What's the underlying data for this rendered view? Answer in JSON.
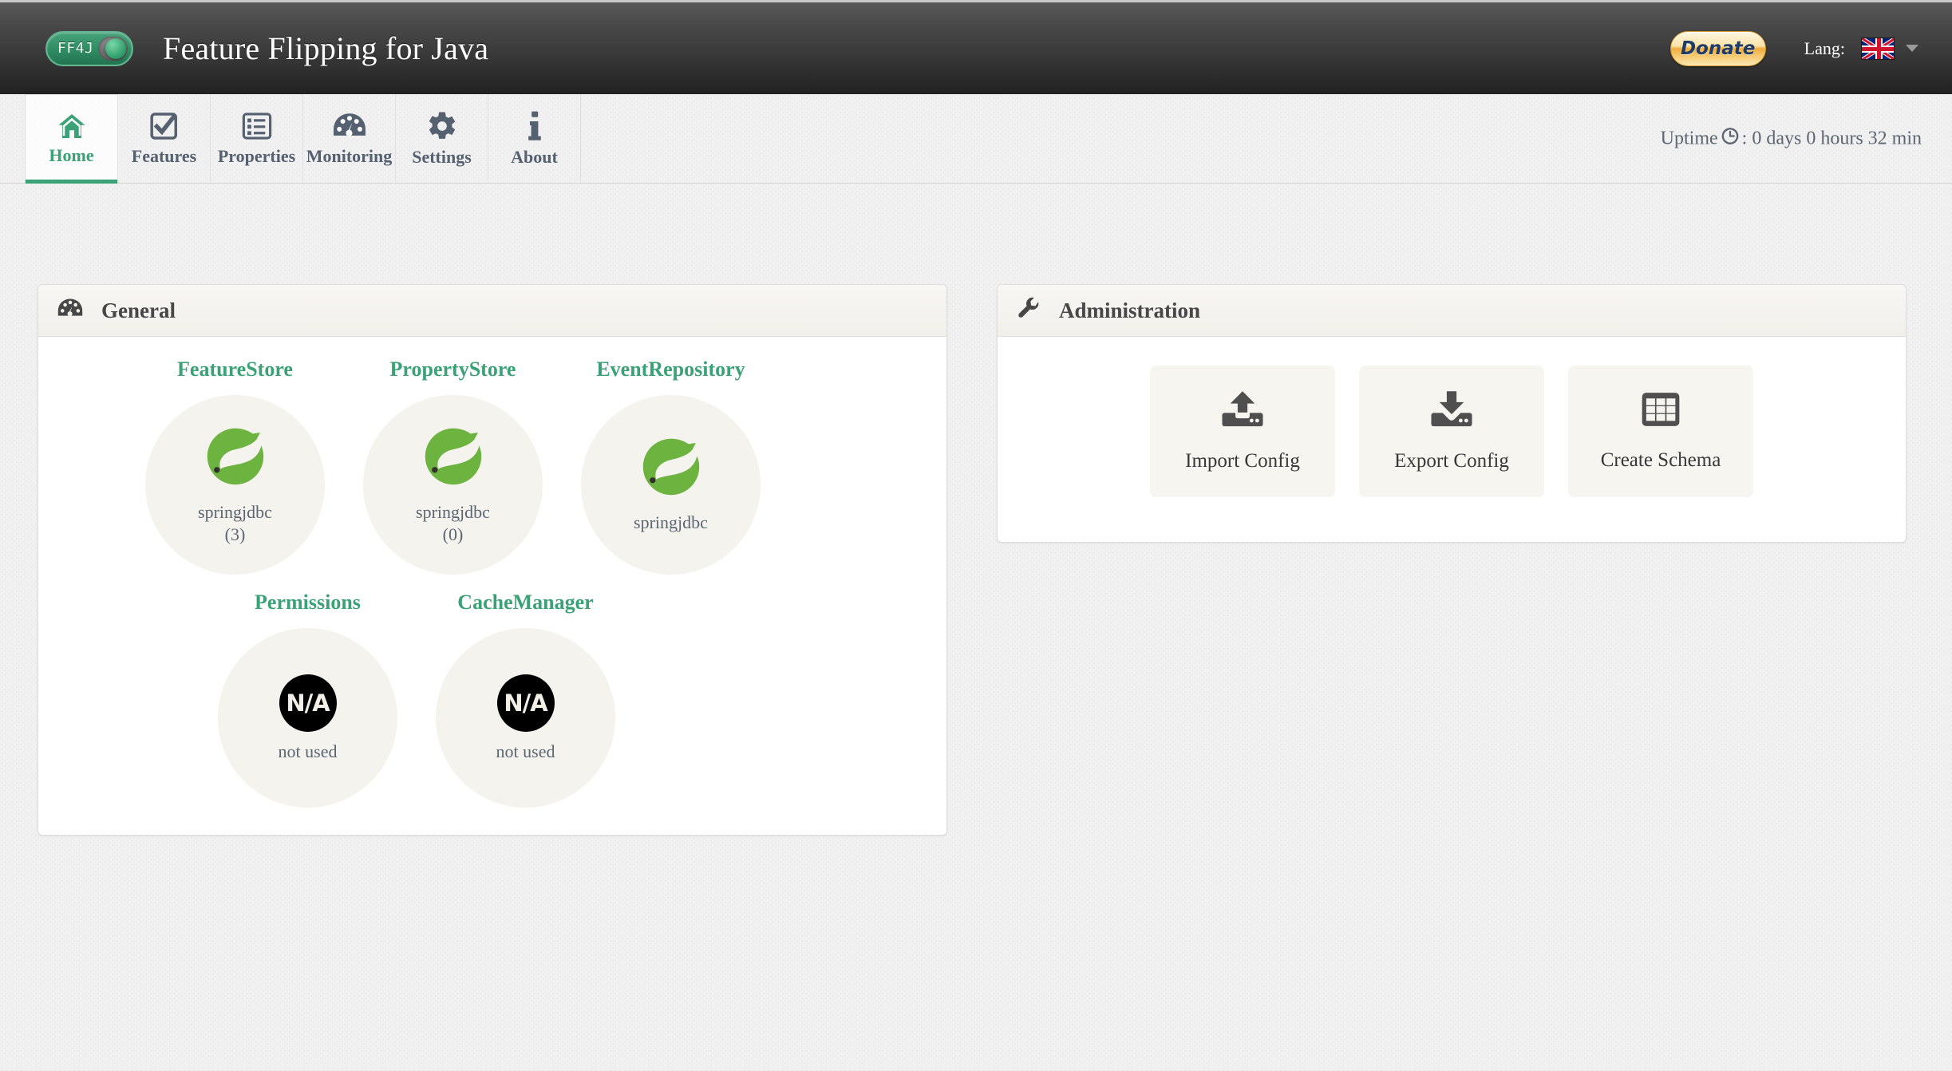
{
  "header": {
    "logo_text": "FF4J",
    "logo_icon": "toggle-switch-icon",
    "app_title": "Feature Flipping for Java",
    "donate_label": "Donate",
    "lang_label": "Lang:",
    "flag_icon": "uk-flag-icon",
    "caret_icon": "chevron-down-icon",
    "brand_green": "#3aa276",
    "donate_orange": "#f0ad3e"
  },
  "nav": {
    "items": [
      {
        "label": "Home",
        "icon": "home-icon",
        "active": true
      },
      {
        "label": "Features",
        "icon": "check-square-icon",
        "active": false
      },
      {
        "label": "Properties",
        "icon": "list-icon",
        "active": false
      },
      {
        "label": "Monitoring",
        "icon": "gauge-icon",
        "active": false
      },
      {
        "label": "Settings",
        "icon": "gear-icon",
        "active": false
      },
      {
        "label": "About",
        "icon": "info-icon",
        "active": false
      }
    ],
    "uptime_prefix": "Uptime",
    "uptime_icon": "clock-icon",
    "uptime_value": ": 0 days 0 hours 32 min"
  },
  "general": {
    "title": "General",
    "icon": "gauge-icon",
    "stores_row1": [
      {
        "name": "FeatureStore",
        "impl": "springjdbc",
        "count": "(3)",
        "icon": "spring-leaf-icon"
      },
      {
        "name": "PropertyStore",
        "impl": "springjdbc",
        "count": "(0)",
        "icon": "spring-leaf-icon"
      },
      {
        "name": "EventRepository",
        "impl": "springjdbc",
        "count": "",
        "icon": "spring-leaf-icon"
      }
    ],
    "stores_row2": [
      {
        "name": "Permissions",
        "impl": "not used",
        "badge": "N/A",
        "icon": "na-icon"
      },
      {
        "name": "CacheManager",
        "impl": "not used",
        "badge": "N/A",
        "icon": "na-icon"
      }
    ]
  },
  "administration": {
    "title": "Administration",
    "icon": "wrench-icon",
    "buttons": [
      {
        "label": "Import Config",
        "icon": "upload-icon"
      },
      {
        "label": "Export Config",
        "icon": "download-icon"
      },
      {
        "label": "Create Schema",
        "icon": "table-grid-icon"
      }
    ]
  }
}
